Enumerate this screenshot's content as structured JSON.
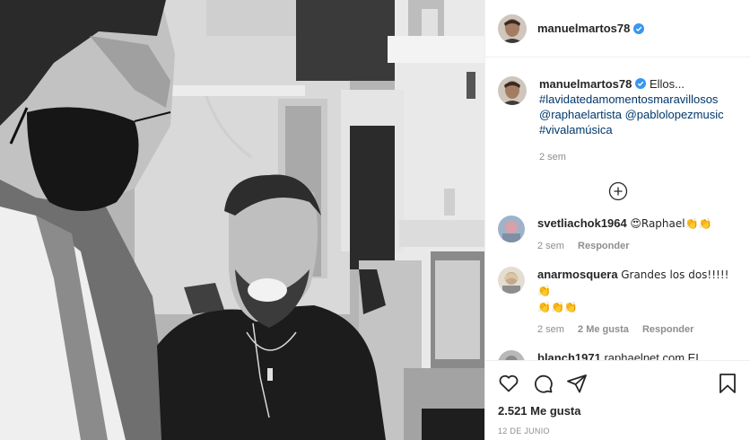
{
  "post": {
    "author": "manuelmartos78",
    "verified": true
  },
  "caption": {
    "author": "manuelmartos78",
    "text": "Ellos...",
    "hashtag1": "#lavidatedamomentosmaravillosos",
    "mention1": "@raphaelartista",
    "mention2": "@pablolopezmusic",
    "hashtag2": "#vivalamúsica",
    "time": "2 sem"
  },
  "comments": [
    {
      "user": "svetliachok1964",
      "text": "😍Raphael👏👏",
      "time": "2 sem",
      "likes": "",
      "reply": "Responder"
    },
    {
      "user": "anarmosquera",
      "text": "Grandes los dos!!!!!👏",
      "text2": "👏👏👏",
      "time": "2 sem",
      "likes": "2 Me gusta",
      "reply": "Responder"
    },
    {
      "user": "blanch1971",
      "text": "raphaelnet com EL MEJOR"
    }
  ],
  "stats": {
    "likes": "2.521 Me gusta",
    "date": "12 DE JUNIO"
  },
  "icons": {
    "like": "heart-outline-icon",
    "comment": "speech-bubble-icon",
    "share": "paper-plane-icon",
    "save": "bookmark-icon",
    "more": "plus-circle-icon",
    "verified": "verified-badge-icon"
  },
  "colors": {
    "link": "#00376b",
    "verified": "#3897f0",
    "muted": "#8e8e8e",
    "text": "#262626"
  }
}
